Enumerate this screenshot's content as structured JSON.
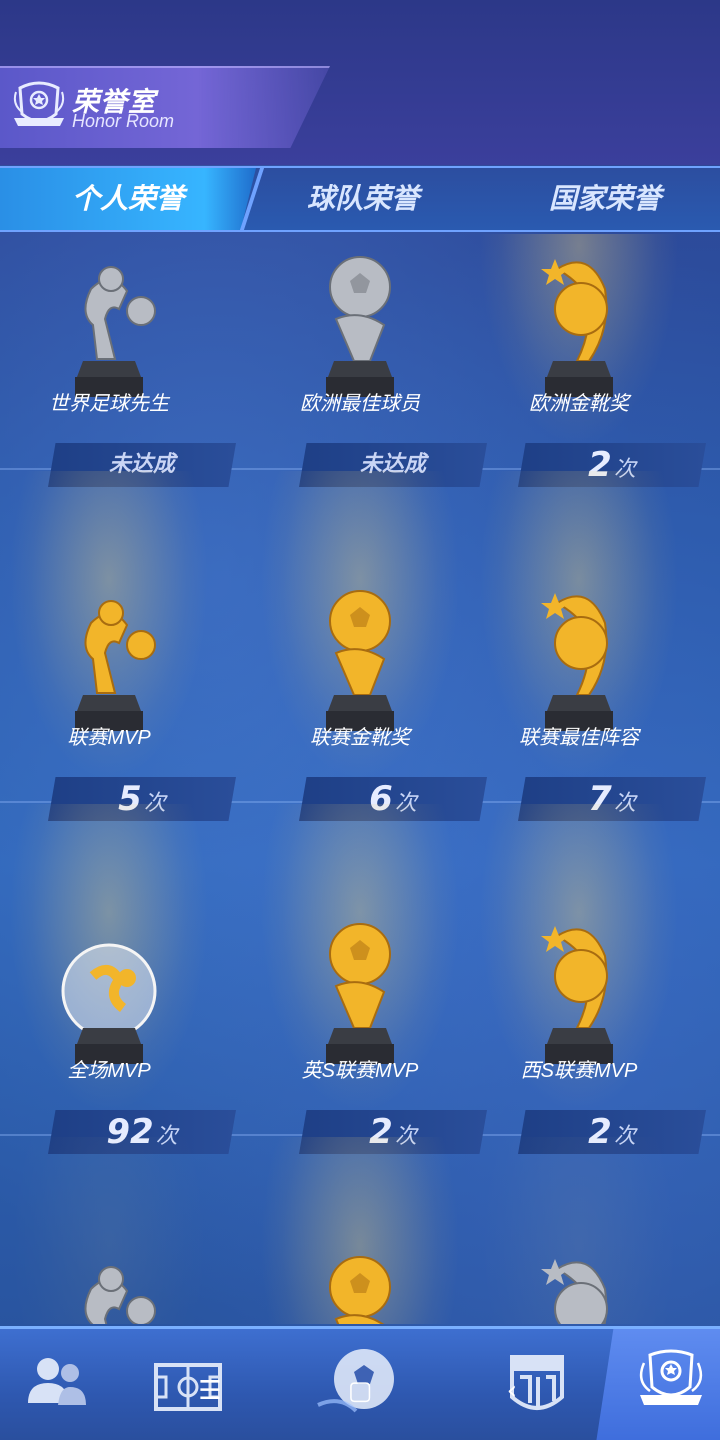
{
  "header": {
    "title_cn": "荣誉室",
    "title_en": "Honor Room"
  },
  "tabs": [
    {
      "label": "个人荣誉",
      "active": true
    },
    {
      "label": "球队荣誉",
      "active": false
    },
    {
      "label": "国家荣誉",
      "active": false
    }
  ],
  "awards": [
    {
      "name": "世界足球先生",
      "count": "",
      "status": "未达成",
      "style": "silver"
    },
    {
      "name": "欧洲最佳球员",
      "count": "",
      "status": "未达成",
      "style": "silver"
    },
    {
      "name": "欧洲金靴奖",
      "count": "2",
      "unit": "次",
      "style": "gold"
    },
    {
      "name": "联赛MVP",
      "count": "5",
      "unit": "次",
      "style": "gold"
    },
    {
      "name": "联赛金靴奖",
      "count": "6",
      "unit": "次",
      "style": "gold"
    },
    {
      "name": "联赛最佳阵容",
      "count": "7",
      "unit": "次",
      "style": "gold"
    },
    {
      "name": "全场MVP",
      "count": "92",
      "unit": "次",
      "style": "crystal"
    },
    {
      "name": "英S联赛MVP",
      "count": "2",
      "unit": "次",
      "style": "gold"
    },
    {
      "name": "西S联赛MVP",
      "count": "2",
      "unit": "次",
      "style": "gold"
    },
    {
      "name": "",
      "count": "",
      "unit": "",
      "style": "silver"
    },
    {
      "name": "",
      "count": "",
      "unit": "",
      "style": "gold"
    },
    {
      "name": "",
      "count": "",
      "unit": "",
      "style": "silver"
    }
  ],
  "bottom_nav": [
    {
      "icon": "players-icon"
    },
    {
      "icon": "pitch-icon"
    },
    {
      "icon": "football-icon"
    },
    {
      "icon": "club-badge-icon"
    },
    {
      "icon": "trophy-icon",
      "active": true
    }
  ],
  "colors": {
    "gold": "#f2b52a",
    "silver": "#b8bcc4",
    "accent": "#37b5ff"
  }
}
